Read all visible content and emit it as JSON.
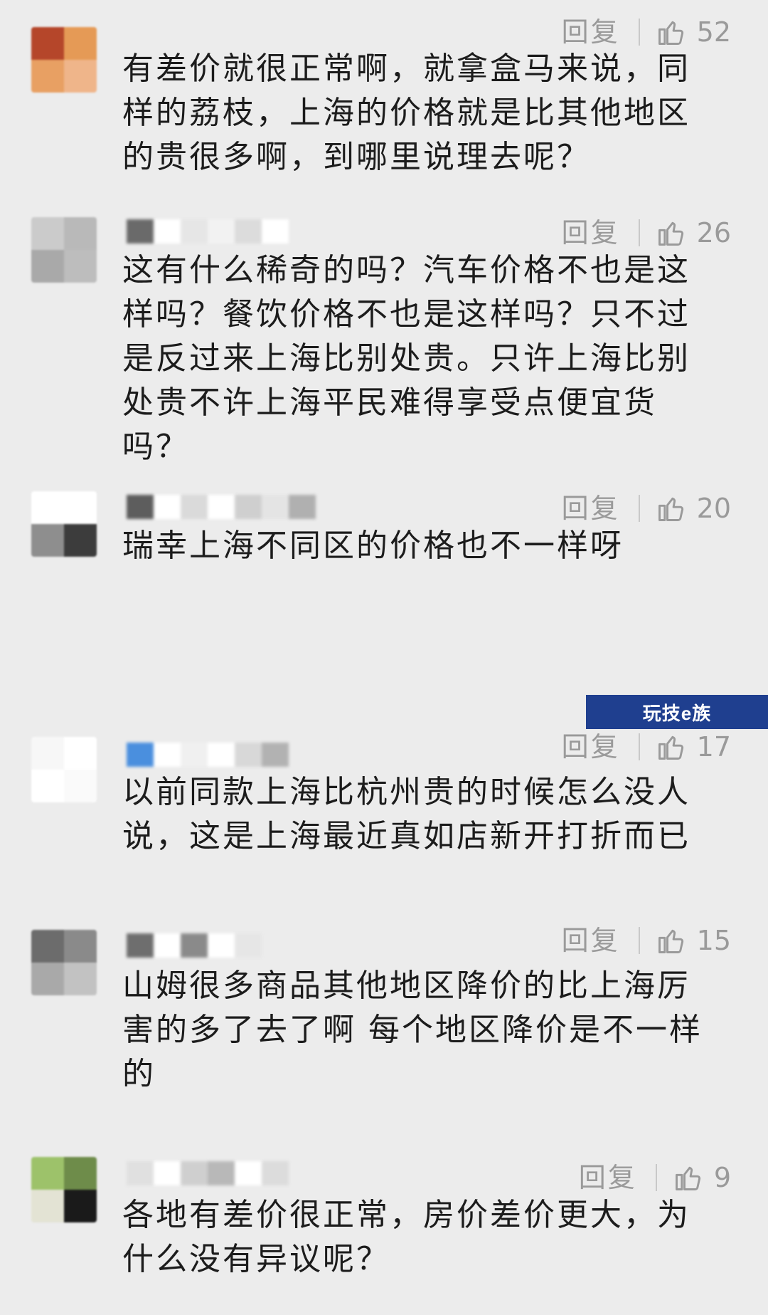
{
  "comments": [
    {
      "reply_label": "回复",
      "like_count": "52",
      "text": "有差价就很正常啊，就拿盒马来说，同样的荔枝，上海的价格就是比其他地区的贵很多啊，到哪里说理去呢？",
      "avatar_colors": [
        "#b5462a",
        "#e59a56",
        "#e8a063",
        "#efb58a"
      ],
      "name_colors": []
    },
    {
      "reply_label": "回复",
      "like_count": "26",
      "text": "这有什么稀奇的吗？汽车价格不也是这样吗？餐饮价格不也是这样吗？只不过是反过来上海比别处贵。只许上海比别处贵不许上海平民难得享受点便宜货吗？",
      "avatar_colors": [
        "#cbcbcb",
        "#b9b9b9",
        "#a9a9a9",
        "#bdbdbd"
      ],
      "name_colors": [
        "#6a6a6a",
        "#ffffff",
        "#e6e6e6",
        "#f2f2f2",
        "#dcdcdc",
        "#ffffff"
      ]
    },
    {
      "reply_label": "回复",
      "like_count": "20",
      "text": "瑞幸上海不同区的价格也不一样呀",
      "avatar_colors": [
        "#ffffff",
        "#ffffff",
        "#8e8e8e",
        "#3c3c3c"
      ],
      "name_colors": [
        "#5d5d5d",
        "#ffffff",
        "#dadada",
        "#ffffff",
        "#cfcfcf",
        "#e4e4e4",
        "#b0b0b0"
      ]
    },
    {
      "reply_label": "回复",
      "like_count": "17",
      "text": "以前同款上海比杭州贵的时候怎么没人说，这是上海最近真如店新开打折而已",
      "avatar_colors": [
        "#f7f7f7",
        "#ffffff",
        "#ffffff",
        "#fafafa"
      ],
      "name_colors": [
        "#4a8fde",
        "#ffffff",
        "#f0f0f0",
        "#ffffff",
        "#d8d8d8",
        "#b2b2b2"
      ]
    },
    {
      "reply_label": "回复",
      "like_count": "15",
      "text": "山姆很多商品其他地区降价的比上海厉害的多了去了啊 每个地区降价是不一样的",
      "avatar_colors": [
        "#6c6c6c",
        "#8a8a8a",
        "#a9a9a9",
        "#c2c2c2"
      ],
      "name_colors": [
        "#6e6e6e",
        "#ffffff",
        "#8a8a8a",
        "#ffffff",
        "#e6e6e6"
      ]
    },
    {
      "reply_label": "回复",
      "like_count": "9",
      "text": "各地有差价很正常，房价差价更大，为什么没有异议呢？",
      "avatar_colors": [
        "#9dc26a",
        "#6e8c4a",
        "#e3e3d4",
        "#1a1a1a"
      ],
      "name_colors": [
        "#e0e0e0",
        "#ffffff",
        "#cfcfcf",
        "#b8b8b8",
        "#ffffff",
        "#dcdcdc"
      ]
    }
  ],
  "watermark": "玩技e族",
  "colors": {
    "background": "#ececec",
    "text": "#1c1c1c",
    "meta": "#9a9a9a"
  }
}
